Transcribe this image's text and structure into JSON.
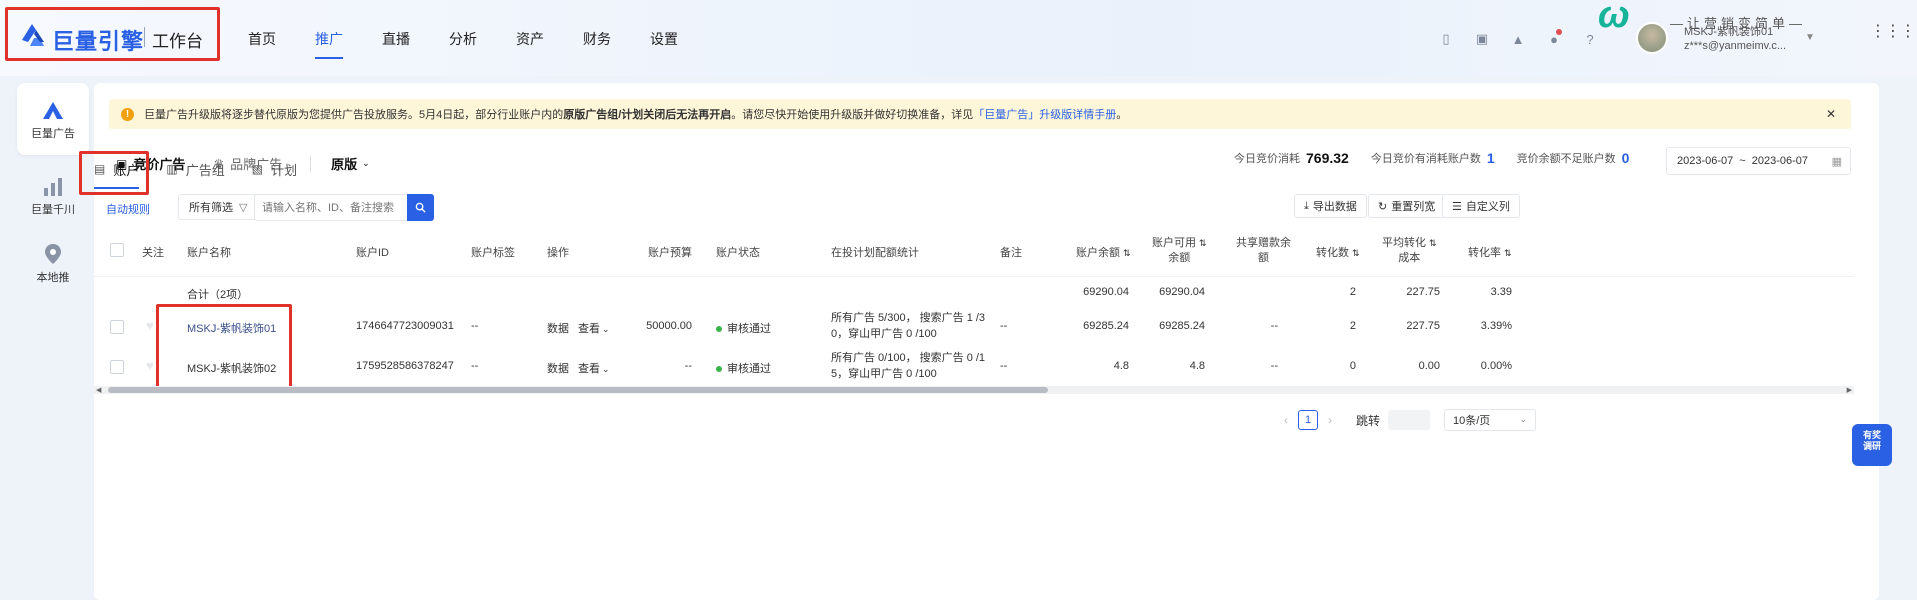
{
  "header": {
    "logo": "巨量引擎",
    "workspace": "工作台",
    "nav": [
      "首页",
      "推广",
      "直播",
      "分析",
      "资产",
      "财务",
      "设置"
    ],
    "active_nav": "推广",
    "account_name": "MSKJ-紫帆装饰01",
    "account_email": "z***s@yanmeimv.c...",
    "watermark_slogan": "—让营销变简单—"
  },
  "sidebar": {
    "items": [
      {
        "label": "巨量广告",
        "icon": "juliang-ads-icon"
      },
      {
        "label": "巨量千川",
        "icon": "qianchuan-icon"
      },
      {
        "label": "本地推",
        "icon": "local-push-icon"
      }
    ]
  },
  "notice": {
    "text1": "巨量广告升级版将逐步替代原版为您提供广告投放服务。5月4日起，部分行业账户内的",
    "bold": "原版广告组/计划关闭后无法再开启",
    "text2": "。请您尽快开始使用升级版并做好切换准备，详见",
    "link": "「巨量广告」升级版详情手册",
    "text3": "。"
  },
  "typebar": {
    "bidding": "竞价广告",
    "brand": "品牌广告",
    "version": "原版"
  },
  "stats": {
    "spend_label": "今日竞价消耗",
    "spend_value": "769.32",
    "active_label": "今日竞价有消耗账户数",
    "active_value": "1",
    "low_label": "竞价余额不足账户数",
    "low_value": "0"
  },
  "daterange": {
    "start": "2023-06-07",
    "sep": "~",
    "end": "2023-06-07"
  },
  "subtabs": [
    "账户",
    "广告组",
    "计划"
  ],
  "toolbar": {
    "auto_rule": "自动规则",
    "filter": "所有筛选",
    "search_placeholder": "请输入名称、ID、备注搜索",
    "export": "导出数据",
    "reset": "重置列宽",
    "custom": "自定义列"
  },
  "table": {
    "headers": {
      "follow": "关注",
      "name": "账户名称",
      "id": "账户ID",
      "tag": "账户标签",
      "op": "操作",
      "budget": "账户预算",
      "status": "账户状态",
      "plan_stats": "在投计划配额统计",
      "remark": "备注",
      "balance": "账户余额",
      "avail1": "账户可用",
      "avail2": "余额",
      "shared1": "共享赠款余",
      "shared2": "额",
      "conv": "转化数",
      "avgcost1": "平均转化",
      "avgcost2": "成本",
      "rate": "转化率"
    },
    "total": {
      "label": "合计（2项）",
      "balance": "69290.04",
      "avail": "69290.04",
      "conv": "2",
      "avgcost": "227.75",
      "rate": "3.39"
    },
    "rows": [
      {
        "name": "MSKJ-紫帆装饰01",
        "id": "1746647723009031",
        "tag": "--",
        "op_data": "数据",
        "op_view": "查看",
        "budget": "50000.00",
        "status": "审核通过",
        "plan1": "所有广告 5/300， 搜索广告 1 /3",
        "plan2": "0，穿山甲广告 0 /100",
        "remark": "--",
        "balance": "69285.24",
        "avail": "69285.24",
        "shared": "--",
        "conv": "2",
        "avgcost": "227.75",
        "rate": "3.39%"
      },
      {
        "name": "MSKJ-紫帆装饰02",
        "id": "1759528586378247",
        "tag": "--",
        "op_data": "数据",
        "op_view": "查看",
        "budget": "--",
        "status": "审核通过",
        "plan1": "所有广告 0/100， 搜索广告 0 /1",
        "plan2": "5，穿山甲广告 0 /100",
        "remark": "--",
        "balance": "4.8",
        "avail": "4.8",
        "shared": "--",
        "conv": "0",
        "avgcost": "0.00",
        "rate": "0.00%"
      }
    ]
  },
  "pager": {
    "page": "1",
    "jump": "跳转",
    "size": "10条/页"
  },
  "survey": {
    "line1": "有奖",
    "line2": "调研"
  }
}
